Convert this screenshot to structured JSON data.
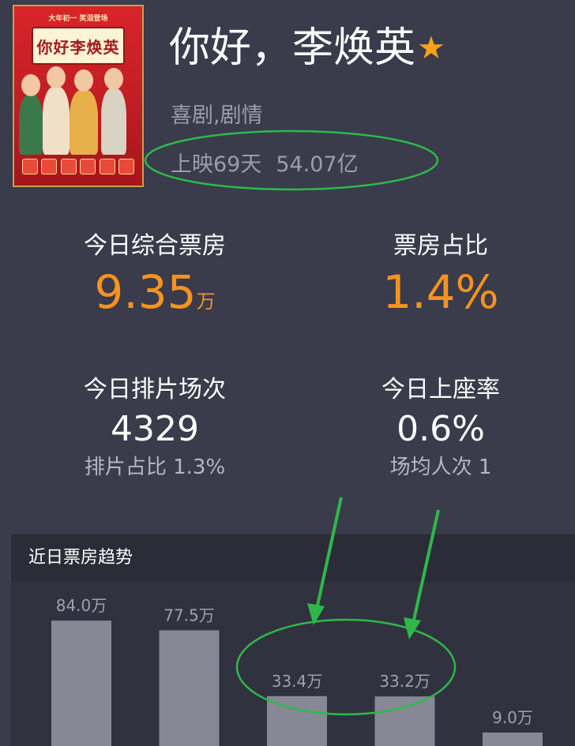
{
  "movie": {
    "title": "你好，李焕英",
    "genres": "喜剧,剧情",
    "release_days": "上映69天",
    "total_box_office": "54.07亿",
    "poster": {
      "tagline": "大年初一 笑泪登场",
      "title": "你好李焕英"
    }
  },
  "stats": {
    "today_box_office": {
      "label": "今日综合票房",
      "value": "9.35",
      "unit": "万"
    },
    "box_office_share": {
      "label": "票房占比",
      "value": "1.4%"
    },
    "today_screenings": {
      "label": "今日排片场次",
      "value": "4329",
      "sub": "排片占比 1.3%"
    },
    "today_occupancy": {
      "label": "今日上座率",
      "value": "0.6%",
      "sub": "场均人次 1"
    }
  },
  "trend": {
    "header": "近日票房趋势"
  },
  "chart_data": {
    "type": "bar",
    "values": [
      84.0,
      77.5,
      33.4,
      33.2,
      9.0
    ],
    "value_labels": [
      "84.0万",
      "77.5万",
      "33.4万",
      "33.2万",
      "9.0万"
    ],
    "ylim": [
      0,
      110
    ],
    "bar_color": "#878896",
    "label_color": "#9fa0ae"
  },
  "colors": {
    "background": "#3a3b4b",
    "accent": "#f7931e",
    "annotation": "#2eb84a"
  }
}
